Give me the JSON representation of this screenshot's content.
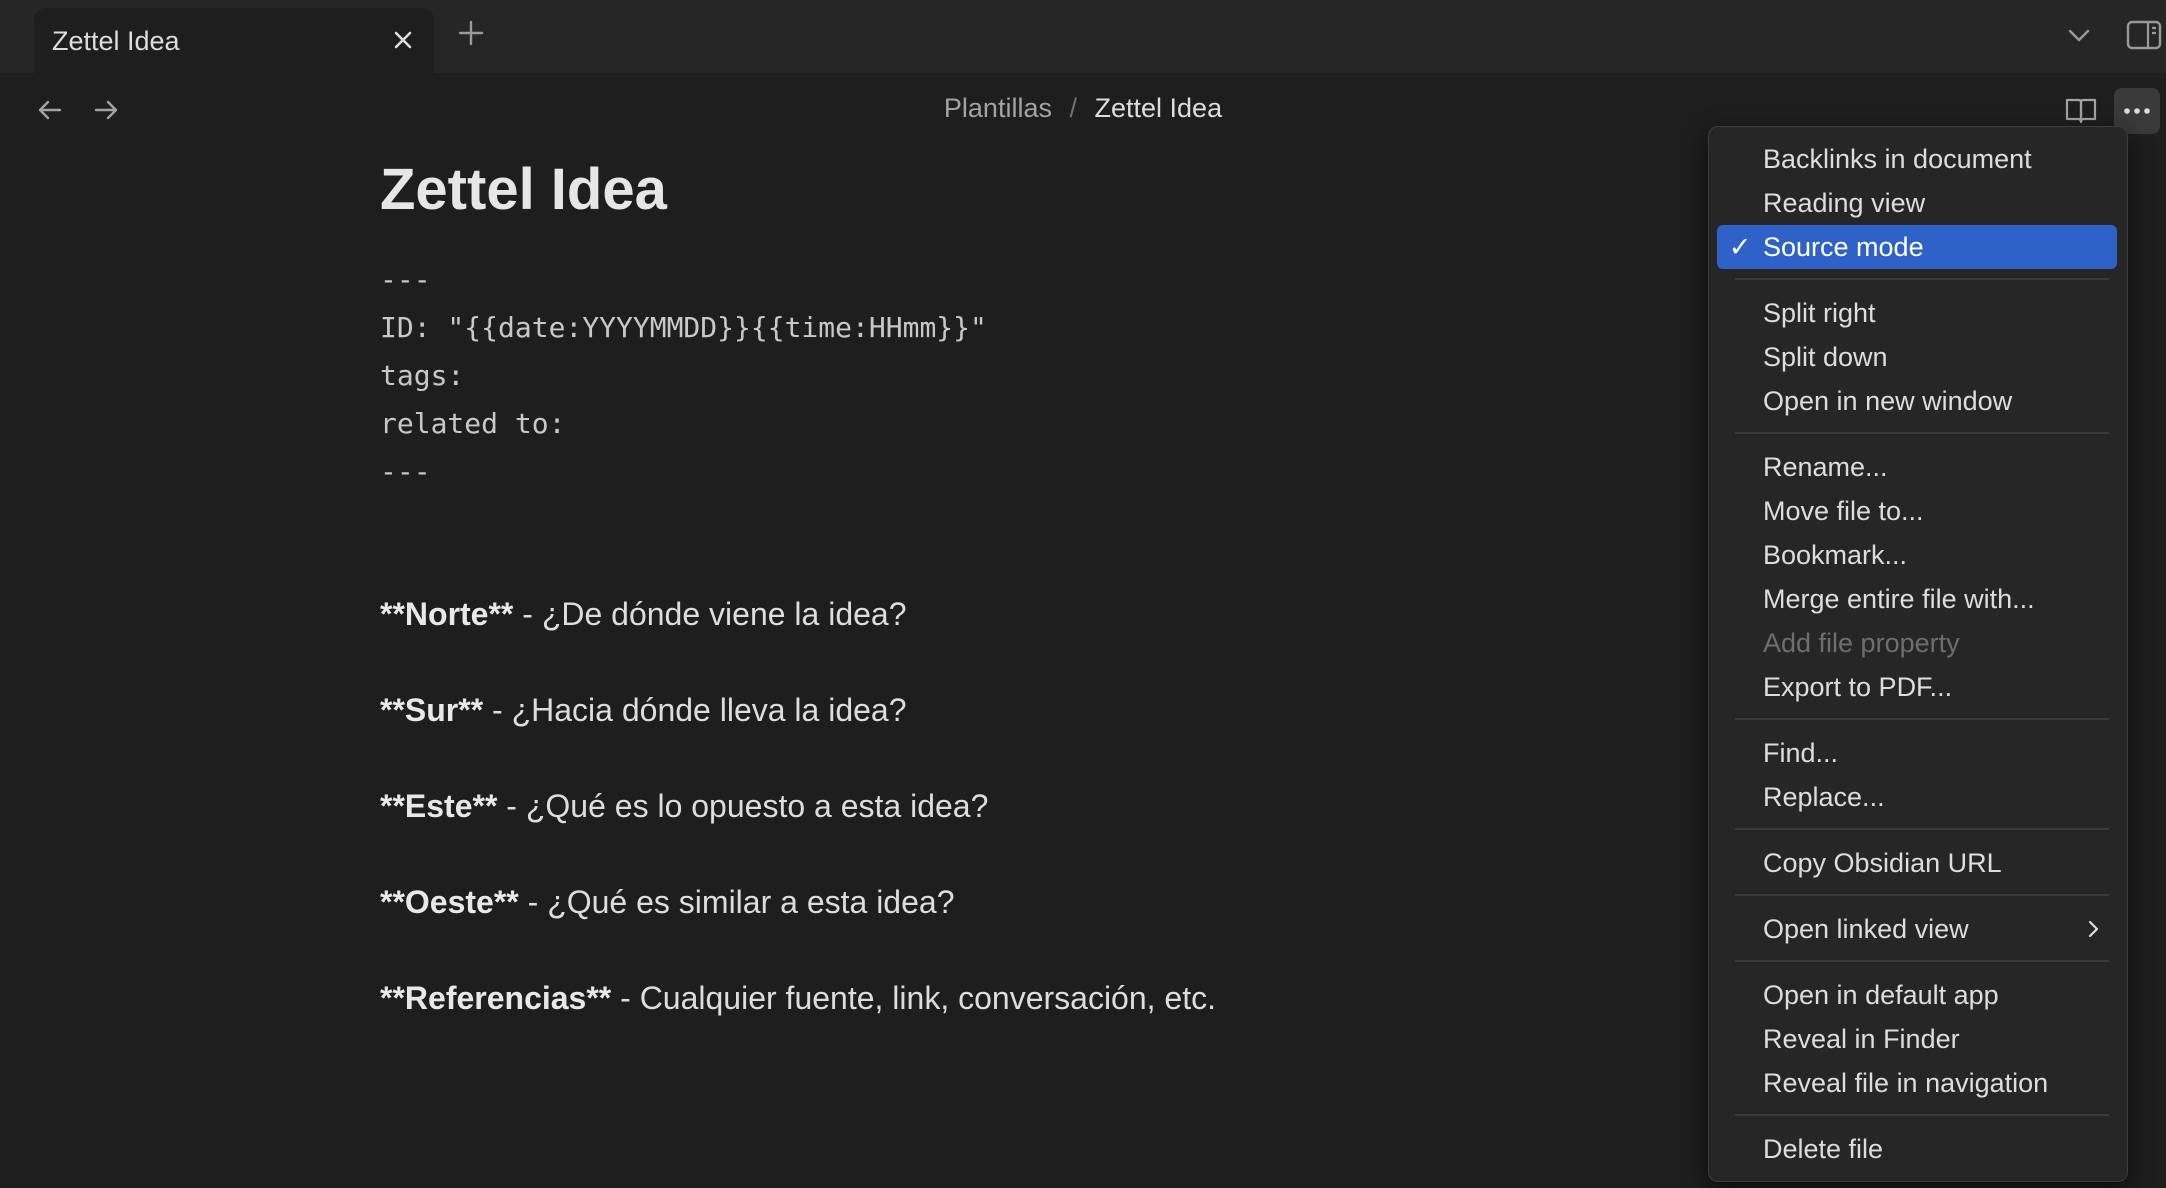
{
  "tab": {
    "title": "Zettel Idea"
  },
  "breadcrumb": {
    "parent": "Plantillas",
    "separator": "/",
    "current": "Zettel Idea"
  },
  "note": {
    "title": "Zettel Idea",
    "frontmatter": [
      "---",
      "ID: \"{{date:YYYYMMDD}}{{time:HHmm}}\"",
      "tags:",
      "related to:",
      "---"
    ],
    "paragraphs": [
      {
        "label": "**Norte**",
        "text": " - ¿De dónde viene la idea?"
      },
      {
        "label": "**Sur**",
        "text": " - ¿Hacia dónde lleva la idea?"
      },
      {
        "label": "**Este**",
        "text": " - ¿Qué es lo opuesto a esta idea?"
      },
      {
        "label": "**Oeste**",
        "text": " - ¿Qué es similar a esta idea?"
      },
      {
        "label": "**Referencias**",
        "text": " - Cualquier fuente, link, conversación, etc."
      }
    ]
  },
  "menu": {
    "check_glyph": "✓",
    "items": [
      {
        "label": "Backlinks in document"
      },
      {
        "label": "Reading view"
      },
      {
        "label": "Source mode",
        "checked": true
      },
      {
        "label": "Split right"
      },
      {
        "label": "Split down"
      },
      {
        "label": "Open in new window"
      },
      {
        "label": "Rename..."
      },
      {
        "label": "Move file to..."
      },
      {
        "label": "Bookmark..."
      },
      {
        "label": "Merge entire file with..."
      },
      {
        "label": "Add file property",
        "disabled": true
      },
      {
        "label": "Export to PDF..."
      },
      {
        "label": "Find..."
      },
      {
        "label": "Replace..."
      },
      {
        "label": "Copy Obsidian URL"
      },
      {
        "label": "Open linked view",
        "submenu": true
      },
      {
        "label": "Open in default app"
      },
      {
        "label": "Reveal in Finder"
      },
      {
        "label": "Reveal file in navigation"
      },
      {
        "label": "Delete file"
      }
    ]
  },
  "colors": {
    "accent": "#2f62c9",
    "background": "#1e1e1e",
    "tabbar": "#262626"
  }
}
